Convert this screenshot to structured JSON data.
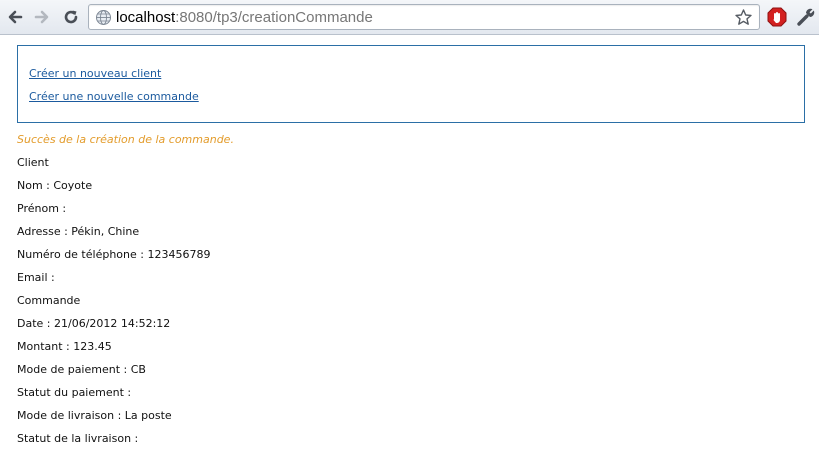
{
  "browser": {
    "url_host": "localhost",
    "url_rest": ":8080/tp3/creationCommande"
  },
  "menu": {
    "new_client_link": "Créer un nouveau client",
    "new_order_link": "Créer une nouvelle commande"
  },
  "message": {
    "success": "Succès de la création de la commande."
  },
  "client": {
    "heading": "Client",
    "nom": "Nom : Coyote",
    "prenom": "Prénom : ",
    "adresse": "Adresse : Pékin, Chine",
    "telephone": "Numéro de téléphone : 123456789",
    "email": "Email : "
  },
  "commande": {
    "heading": "Commande",
    "date": "Date : 21/06/2012 14:52:12",
    "montant": "Montant : 123.45",
    "mode_paiement": "Mode de paiement : CB",
    "statut_paiement": "Statut du paiement : ",
    "mode_livraison": "Mode de livraison : La poste",
    "statut_livraison": "Statut de la livraison : "
  },
  "colors": {
    "link": "#1b5a9e",
    "success": "#e39c2c",
    "box_border": "#2b6fa6"
  }
}
